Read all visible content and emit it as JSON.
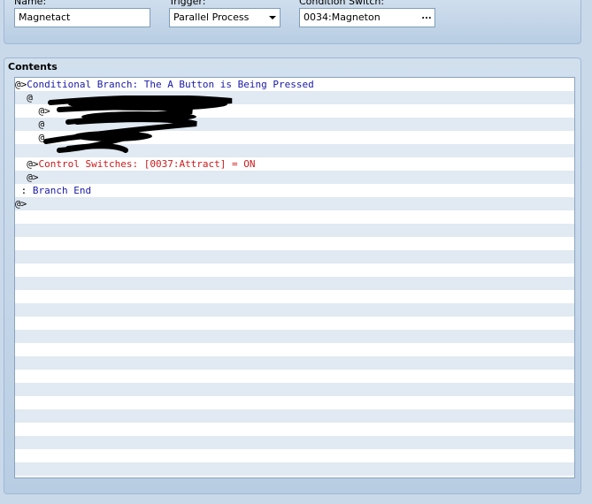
{
  "name_field": {
    "label": "Name:",
    "value": "Magnetact"
  },
  "trigger_field": {
    "label": "Trigger:",
    "value": "Parallel Process"
  },
  "condition_field": {
    "label": "Condition Switch:",
    "value": "0034:Magneton",
    "button": "..."
  },
  "contents": {
    "title": "Contents",
    "rows": [
      {
        "prefix": "@>",
        "text": "Conditional Branch: The A Button is Being Pressed",
        "color": "#1a1aa6"
      },
      {
        "prefix": "  @",
        "text": "",
        "color": "#000000"
      },
      {
        "prefix": "    @>",
        "text": "",
        "color": "#1a1aa6"
      },
      {
        "prefix": "    @",
        "text": "",
        "color": "#000000"
      },
      {
        "prefix": "    @",
        "text": "",
        "color": "#000000"
      },
      {
        "prefix": "  ",
        "text": "",
        "color": "#1a1aa6"
      },
      {
        "prefix": "  @>",
        "text": "Control Switches: [0037:Attract] = ON",
        "color": "#cc1a1a"
      },
      {
        "prefix": "  @>",
        "text": "",
        "color": "#000000"
      },
      {
        "prefix": " : ",
        "text": "Branch End",
        "color": "#1a1aa6"
      },
      {
        "prefix": "@>",
        "text": "",
        "color": "#000000"
      }
    ]
  },
  "colors": {
    "command_blue": "#1a1aa6",
    "command_red": "#cc1a1a",
    "row_stripe": "#e1e9f2"
  }
}
